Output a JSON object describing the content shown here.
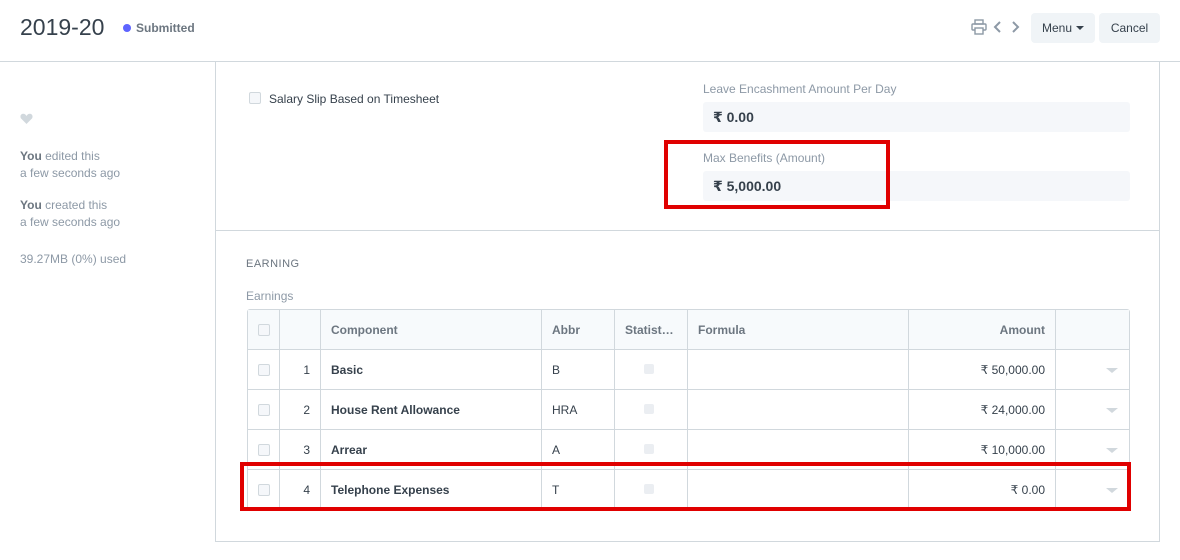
{
  "header": {
    "title": "2019-20",
    "status": "Submitted",
    "menu_label": "Menu",
    "cancel_label": "Cancel"
  },
  "sidebar": {
    "timeline": [
      {
        "actor": "You",
        "action": " edited this",
        "time": "a few seconds ago"
      },
      {
        "actor": "You",
        "action": " created this",
        "time": "a few seconds ago"
      }
    ],
    "usage": "39.27MB (0%) used"
  },
  "form": {
    "salary_slip_timesheet_label": "Salary Slip Based on Timesheet",
    "leave_encashment_label": "Leave Encashment Amount Per Day",
    "leave_encashment_value": "₹ 0.00",
    "max_benefits_label": "Max Benefits (Amount)",
    "max_benefits_value": "₹ 5,000.00"
  },
  "earning_section": {
    "heading": "EARNING",
    "grid_label": "Earnings",
    "columns": [
      "Component",
      "Abbr",
      "Statist…",
      "Formula",
      "Amount"
    ],
    "rows": [
      {
        "idx": "1",
        "component": "Basic",
        "abbr": "B",
        "formula": "",
        "amount": "₹ 50,000.00"
      },
      {
        "idx": "2",
        "component": "House Rent Allowance",
        "abbr": "HRA",
        "formula": "",
        "amount": "₹ 24,000.00"
      },
      {
        "idx": "3",
        "component": "Arrear",
        "abbr": "A",
        "formula": "",
        "amount": "₹ 10,000.00"
      },
      {
        "idx": "4",
        "component": "Telephone Expenses",
        "abbr": "T",
        "formula": "",
        "amount": "₹ 0.00"
      }
    ]
  },
  "colors": {
    "accent": "#5e64ff",
    "highlight": "#e00000",
    "border": "#d1d8dd"
  }
}
